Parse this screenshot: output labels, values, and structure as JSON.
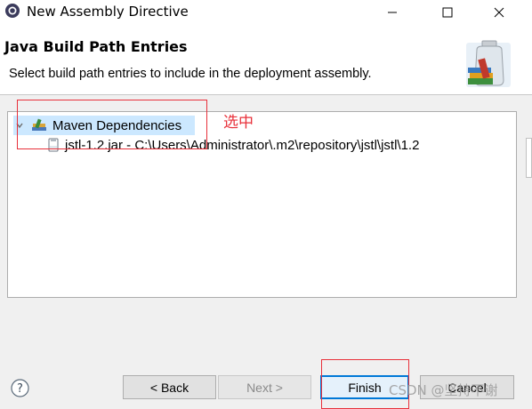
{
  "window": {
    "title": "New Assembly Directive",
    "controls": [
      "minimize-icon",
      "maximize-icon",
      "close-icon"
    ]
  },
  "header": {
    "title": "Java Build Path Entries",
    "description": "Select build path entries to include in the deployment assembly."
  },
  "tree": {
    "items": [
      {
        "label": "Maven Dependencies",
        "icon": "library-icon",
        "expanded": true,
        "selected": true
      },
      {
        "label": "jstl-1.2.jar - C:\\Users\\Administrator\\.m2\\repository\\jstl\\jstl\\1.2",
        "icon": "jar-icon"
      }
    ]
  },
  "annotation": {
    "text": "选中",
    "color": "#e8303a"
  },
  "buttons": {
    "back": "< Back",
    "next": "Next >",
    "finish": "Finish",
    "cancel": "Cancel"
  },
  "watermark": "CSDN @坚持不谢",
  "colors": {
    "selection": "#cce8ff",
    "annotation": "#e8303a",
    "focus_border": "#0078d7"
  }
}
